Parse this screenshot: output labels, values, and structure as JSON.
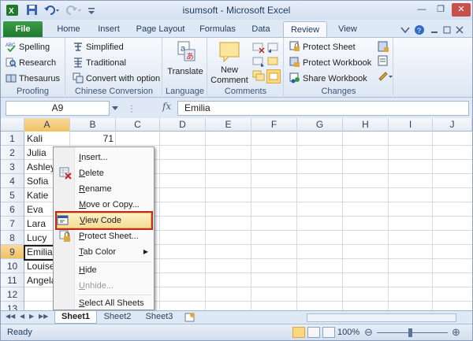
{
  "window": {
    "title": "isumsoft - Microsoft Excel"
  },
  "tabs": [
    "File",
    "Home",
    "Insert",
    "Page Layout",
    "Formulas",
    "Data",
    "Review",
    "View"
  ],
  "ribbon": {
    "proofing": {
      "label": "Proofing",
      "spelling": "Spelling",
      "research": "Research",
      "thesaurus": "Thesaurus"
    },
    "chinese": {
      "label": "Chinese Conversion",
      "simplified": "Simplified",
      "traditional": "Traditional",
      "convert": "Convert with option"
    },
    "language": {
      "label": "Language",
      "translate": "Translate"
    },
    "comments": {
      "label": "Comments",
      "new_comment_line1": "New",
      "new_comment_line2": "Comment"
    },
    "changes": {
      "label": "Changes",
      "protect_sheet": "Protect Sheet",
      "protect_workbook": "Protect Workbook",
      "share_workbook": "Share Workbook"
    }
  },
  "formula_bar": {
    "name_box": "A9",
    "fx": "fx",
    "content": "Emilia"
  },
  "columns": [
    "A",
    "B",
    "C",
    "D",
    "E",
    "F",
    "G",
    "H",
    "I",
    "J"
  ],
  "rows": [
    "1",
    "2",
    "3",
    "4",
    "5",
    "6",
    "7",
    "8",
    "9",
    "10",
    "11",
    "12",
    "13"
  ],
  "cells": {
    "a": [
      "Kali",
      "Julia",
      "Ashley",
      "Sofia",
      "Katie",
      "Eva",
      "Lara",
      "Lucy",
      "Emilia",
      "Louise",
      "Angela",
      "",
      ""
    ],
    "b1": "71"
  },
  "context_menu": [
    {
      "label": "Insert...",
      "u": "I",
      "rest": "nsert..."
    },
    {
      "label": "Delete",
      "u": "D",
      "rest": "elete"
    },
    {
      "label": "Rename",
      "u": "R",
      "rest": "ename"
    },
    {
      "label": "Move or Copy...",
      "u": "M",
      "rest": "ove or Copy..."
    },
    {
      "label": "View Code",
      "u": "V",
      "rest": "iew Code"
    },
    {
      "label": "Protect Sheet...",
      "u": "P",
      "rest": "rotect Sheet..."
    },
    {
      "label": "Tab Color",
      "u": "T",
      "rest": "ab Color"
    },
    {
      "label": "Hide",
      "u": "H",
      "rest": "ide"
    },
    {
      "label": "Unhide...",
      "u": "U",
      "rest": "nhide..."
    },
    {
      "label": "Select All Sheets",
      "u": "S",
      "rest": "elect All Sheets"
    }
  ],
  "sheets": [
    "Sheet1",
    "Sheet2",
    "Sheet3"
  ],
  "status": {
    "ready": "Ready",
    "zoom": "100%"
  },
  "colors": {
    "accent_file": "#1f7a2c",
    "selection": "#f1c15f",
    "highlight_border": "#c0272d"
  }
}
